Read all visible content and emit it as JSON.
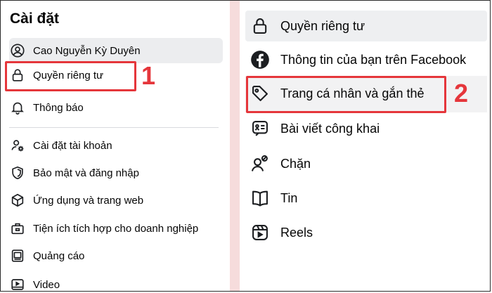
{
  "left": {
    "title": "Cài đặt",
    "items": [
      {
        "label": "Cao Nguyễn Kỳ Duyên",
        "icon": "user-circle-icon"
      },
      {
        "label": "Quyền riêng tư",
        "icon": "lock-icon"
      },
      {
        "label": "Thông báo",
        "icon": "bell-icon"
      },
      {
        "label": "Cài đặt tài khoản",
        "icon": "user-gear-icon"
      },
      {
        "label": "Bảo mật và đăng nhập",
        "icon": "shield-icon"
      },
      {
        "label": "Ứng dụng và trang web",
        "icon": "cube-icon"
      },
      {
        "label": "Tiện ích tích hợp cho doanh nghiệp",
        "icon": "business-integration-icon"
      },
      {
        "label": "Quảng cáo",
        "icon": "ad-icon"
      },
      {
        "label": "Video",
        "icon": "video-icon"
      }
    ]
  },
  "right": {
    "items": [
      {
        "label": "Quyền riêng tư",
        "icon": "lock-icon"
      },
      {
        "label": "Thông tin của bạn trên Facebook",
        "icon": "facebook-icon"
      },
      {
        "label": "Trang cá nhân và gắn thẻ",
        "icon": "tag-icon"
      },
      {
        "label": "Bài viết công khai",
        "icon": "public-post-icon"
      },
      {
        "label": "Chặn",
        "icon": "block-user-icon"
      },
      {
        "label": "Tin",
        "icon": "book-icon"
      },
      {
        "label": "Reels",
        "icon": "reels-icon"
      }
    ]
  },
  "annotations": {
    "step1": "1",
    "step2": "2",
    "color": "#e5363b"
  }
}
